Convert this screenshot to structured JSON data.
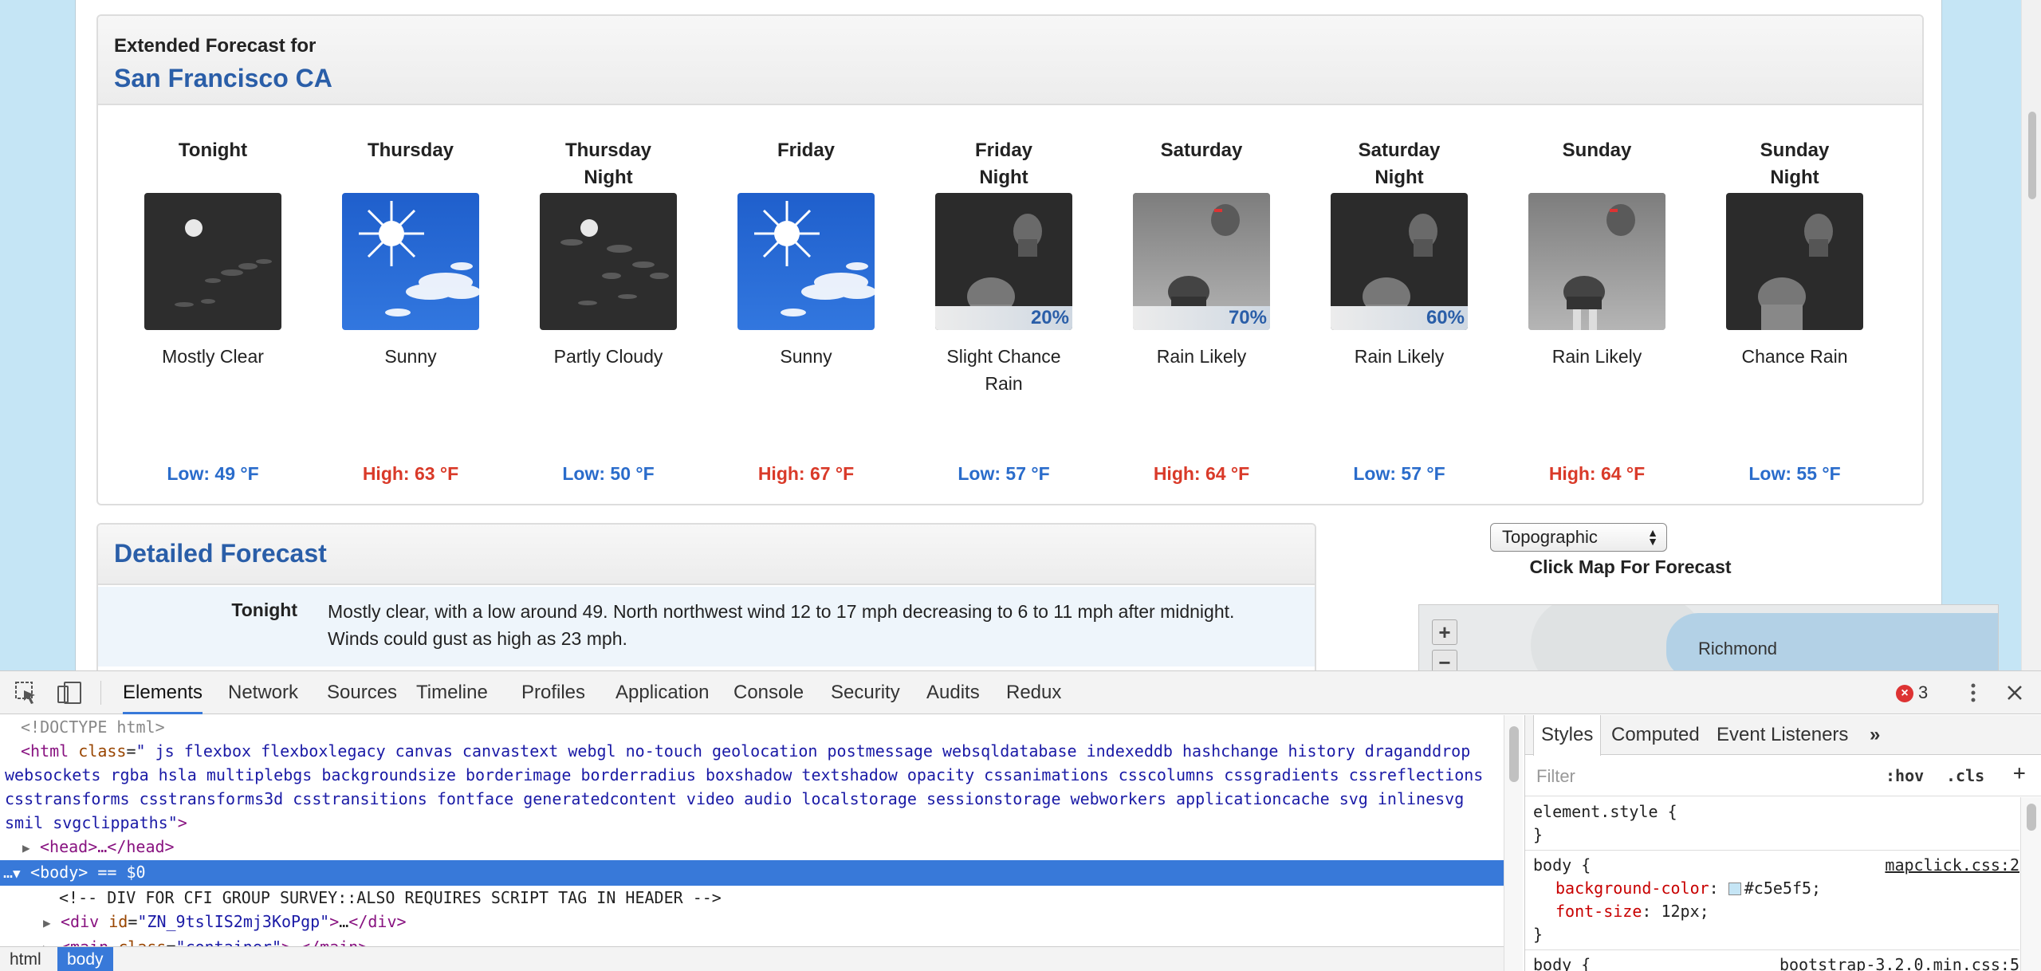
{
  "extended_forecast": {
    "label": "Extended Forecast for",
    "location": "San Francisco CA",
    "periods": [
      {
        "name": "Tonight",
        "icon": "night-clear-icon",
        "pct": "",
        "desc": "Mostly Clear",
        "temp": "Low: 49 °F",
        "kind": "low"
      },
      {
        "name": "Thursday",
        "icon": "sunny-icon",
        "pct": "",
        "desc": "Sunny",
        "temp": "High: 63 °F",
        "kind": "high"
      },
      {
        "name": "Thursday Night",
        "icon": "night-partly-cloudy-icon",
        "pct": "",
        "desc": "Partly Cloudy",
        "temp": "Low: 50 °F",
        "kind": "low"
      },
      {
        "name": "Friday",
        "icon": "sunny-icon",
        "pct": "",
        "desc": "Sunny",
        "temp": "High: 67 °F",
        "kind": "high"
      },
      {
        "name": "Friday Night",
        "icon": "night-rain-icon",
        "pct": "20%",
        "desc": "Slight Chance Rain",
        "temp": "Low: 57 °F",
        "kind": "low"
      },
      {
        "name": "Saturday",
        "icon": "day-rain-icon",
        "pct": "70%",
        "desc": "Rain Likely",
        "temp": "High: 64 °F",
        "kind": "high"
      },
      {
        "name": "Saturday Night",
        "icon": "night-rain-icon",
        "pct": "60%",
        "desc": "Rain Likely",
        "temp": "Low: 57 °F",
        "kind": "low"
      },
      {
        "name": "Sunday",
        "icon": "day-rain-icon",
        "pct": "",
        "desc": "Rain Likely",
        "temp": "High: 64 °F",
        "kind": "high"
      },
      {
        "name": "Sunday Night",
        "icon": "night-rain-icon",
        "pct": "",
        "desc": "Chance Rain",
        "temp": "Low: 55 °F",
        "kind": "low"
      }
    ]
  },
  "detailed_forecast": {
    "title": "Detailed Forecast",
    "rows": [
      {
        "label": "Tonight",
        "text": "Mostly clear, with a low around 49. North northwest wind 12 to 17 mph decreasing to 6 to 11 mph after midnight. Winds could gust as high as 23 mph."
      }
    ]
  },
  "map": {
    "select_value": "Topographic",
    "caption": "Click Map For Forecast",
    "zoom_in": "+",
    "zoom_out": "−",
    "city_label": "Richmond"
  },
  "devtools": {
    "tabs": [
      "Elements",
      "Network",
      "Sources",
      "Timeline",
      "Profiles",
      "Application",
      "Console",
      "Security",
      "Audits",
      "Redux"
    ],
    "active_tab": "Elements",
    "error_count": "3",
    "breadcrumbs": [
      "html",
      "body"
    ],
    "dom": {
      "doctype": "<!DOCTYPE html>",
      "html_classes": " js flexbox flexboxlegacy canvas canvastext webgl no-touch geolocation postmessage websqldatabase indexeddb hashchange history draganddrop websockets rgba hsla multiplebgs backgroundsize borderimage borderradius boxshadow textshadow opacity cssanimations csscolumns cssgradients cssreflections csstransforms csstransforms3d csstransitions fontface generatedcontent video audio localstorage sessionstorage webworkers applicationcache svg inlinesvg smil svgclippaths",
      "head": "<head>…</head>",
      "body_suffix": " == $0",
      "comment": "<!-- DIV FOR CFI GROUP SURVEY::ALSO REQUIRES SCRIPT TAG IN HEADER -->",
      "div_id": "ZN_9tslIS2mj3KoPgp",
      "main_class": "container"
    },
    "styles": {
      "tabs": [
        "Styles",
        "Computed",
        "Event Listeners"
      ],
      "filter_placeholder": "Filter",
      "hov": ":hov",
      "cls": ".cls",
      "element_style": "element.style {",
      "body_source": "mapclick.css:2",
      "bg_prop": "background-color",
      "bg_value": "#c5e5f5;",
      "bg_color": "#c5e5f5",
      "fs_prop": "font-size",
      "fs_value": "12px;",
      "body2_source": "bootstrap-3.2.0.min.css:5"
    }
  }
}
